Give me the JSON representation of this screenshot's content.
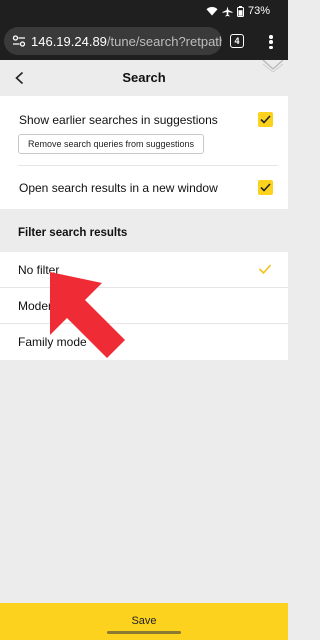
{
  "status_bar": {
    "battery": "73%"
  },
  "browser": {
    "url_host": "146.19.24.89",
    "url_path": "/tune/search?retpath",
    "tab_count": "4"
  },
  "header": {
    "title": "Search"
  },
  "settings": {
    "earlier_searches_label": "Show earlier searches in suggestions",
    "remove_queries_label": "Remove search queries from suggestions",
    "new_window_label": "Open search results in a new window",
    "earlier_searches_checked": true,
    "new_window_checked": true
  },
  "filter": {
    "title": "Filter search results",
    "options": [
      {
        "label": "No filter",
        "selected": true
      },
      {
        "label": "Moderate",
        "selected": false
      },
      {
        "label": "Family mode",
        "selected": false
      }
    ]
  },
  "footer": {
    "save_label": "Save"
  },
  "colors": {
    "accent": "#fcd21e",
    "overlay_arrow": "#ef2b35"
  }
}
